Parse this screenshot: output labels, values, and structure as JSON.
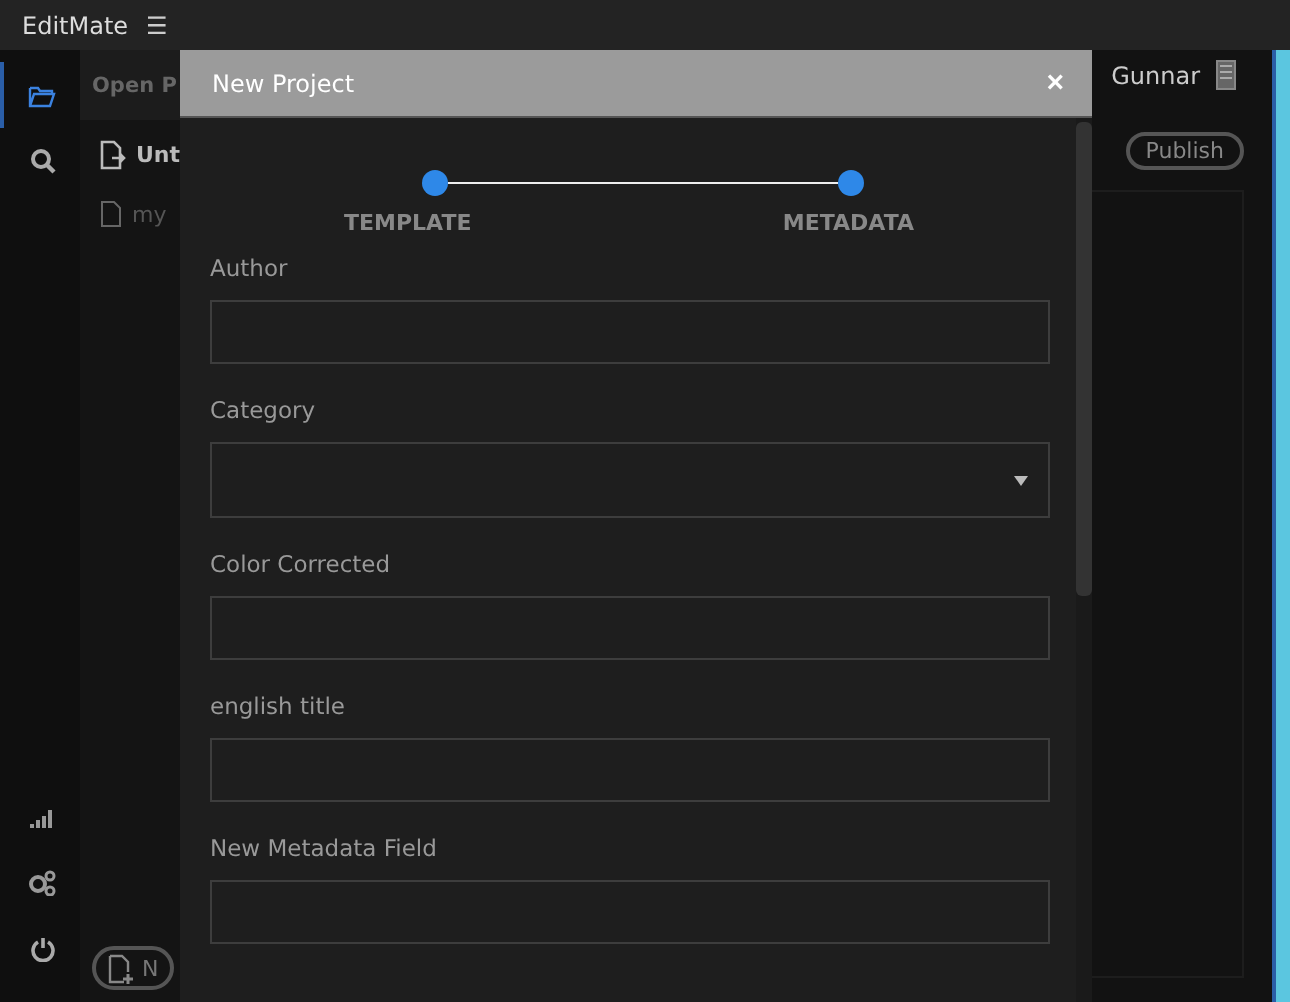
{
  "app": {
    "title": "EditMate",
    "menu_icon": "☰"
  },
  "sidebar": {
    "items": [
      {
        "selected": true
      },
      {
        "selected": false
      }
    ]
  },
  "panel": {
    "header": "Open P",
    "items": [
      {
        "label": "Unt",
        "kind": "project"
      },
      {
        "label": "my",
        "kind": "file"
      }
    ],
    "new_button": "N"
  },
  "user": {
    "name": "Gunnar"
  },
  "publish_button": "Publish",
  "dialog": {
    "title": "New Project",
    "close": "×",
    "steps": [
      {
        "label": "TEMPLATE",
        "done": true
      },
      {
        "label": "METADATA",
        "done": true
      }
    ],
    "fields": [
      {
        "label": "Author",
        "kind": "text"
      },
      {
        "label": "Category",
        "kind": "select"
      },
      {
        "label": "Color Corrected",
        "kind": "text"
      },
      {
        "label": "english title",
        "kind": "text"
      },
      {
        "label": "New Metadata Field",
        "kind": "text"
      }
    ]
  }
}
